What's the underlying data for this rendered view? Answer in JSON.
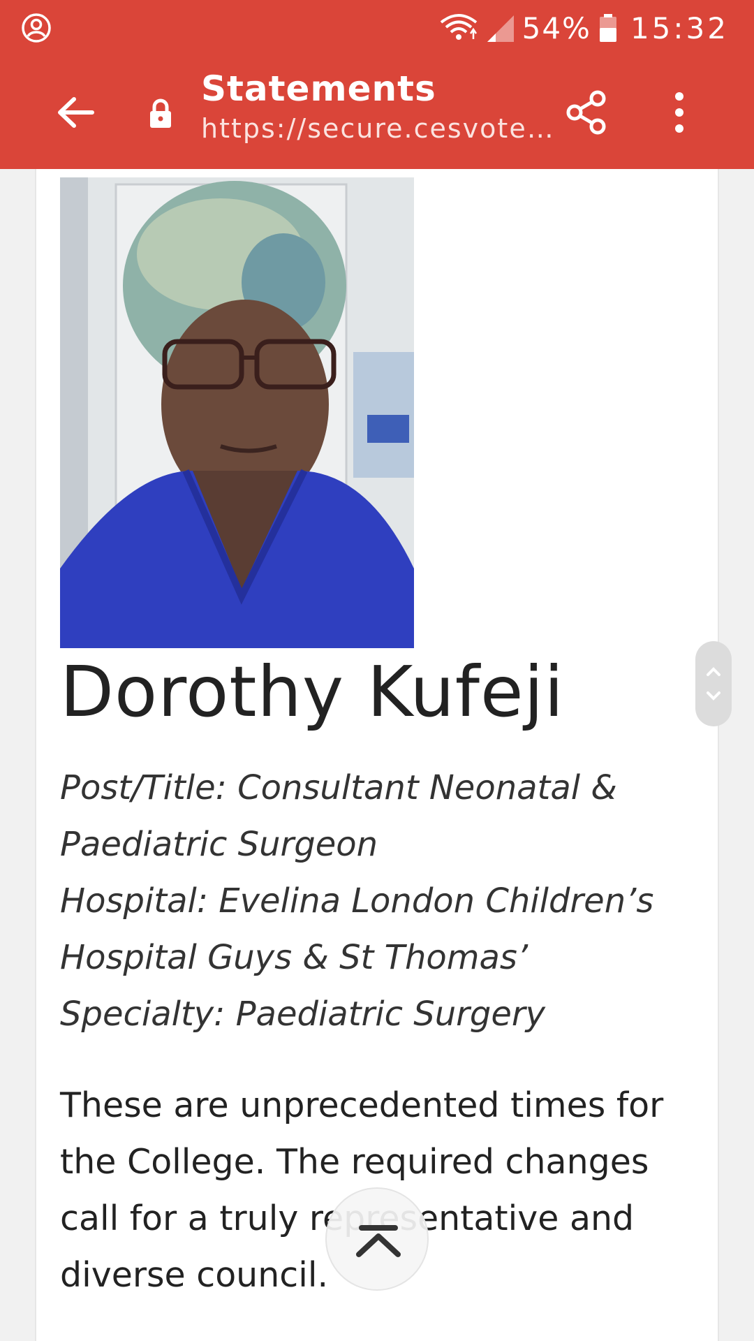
{
  "status_bar": {
    "battery": "54%",
    "time": "15:32"
  },
  "app_bar": {
    "title": "Statements",
    "url": "https://secure.cesvotes...."
  },
  "profile": {
    "name": "Dorothy Kufeji",
    "details": [
      "Post/Title: Consultant Neonatal &",
      "Paediatric Surgeon",
      "Hospital: Evelina London Children’s",
      "Hospital Guys & St Thomas’",
      "Specialty: Paediatric Surgery"
    ],
    "statement_lines": [
      "These are unprecedented times for",
      "the College. The required changes",
      "call for a truly representative and",
      "diverse council."
    ]
  },
  "icons": {
    "status_left": "account-circle-icon",
    "wifi": "wifi-icon",
    "signal": "signal-icon",
    "battery": "battery-icon",
    "back": "arrow-left-icon",
    "lock": "lock-icon",
    "share": "share-icon",
    "more": "more-vertical-icon",
    "scroll": "scroll-handle",
    "to_top": "chevron-up-icon"
  },
  "colors": {
    "app_bar": "#da4539",
    "background": "#f1f1f1"
  }
}
